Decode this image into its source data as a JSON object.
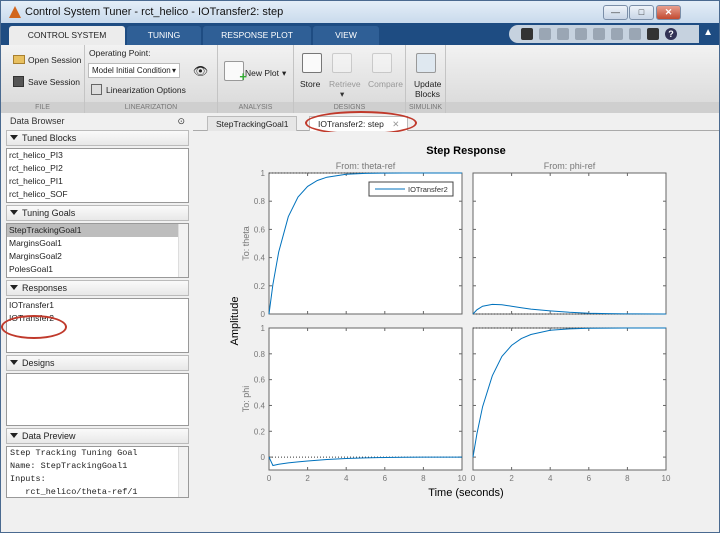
{
  "window": {
    "title": "Control System Tuner - rct_helico - IOTransfer2: step",
    "controls": [
      "minimize",
      "maximize",
      "close"
    ]
  },
  "ribbon_tabs": [
    {
      "label": "CONTROL SYSTEM",
      "active": true
    },
    {
      "label": "TUNING"
    },
    {
      "label": "RESPONSE PLOT"
    },
    {
      "label": "VIEW"
    }
  ],
  "quick_access": [
    "open-help-icon",
    "save-icon",
    "cut-icon",
    "copy-icon",
    "paste-icon",
    "undo-icon",
    "redo-icon",
    "layout-icon",
    "help-icon"
  ],
  "ribbon": {
    "file": {
      "label": "FILE",
      "open": "Open Session",
      "save": "Save Session"
    },
    "linearization": {
      "label": "LINEARIZATION",
      "op_label": "Operating Point:",
      "op_value": "Model Initial Condition",
      "options": "Linearization Options"
    },
    "analysis": {
      "label": "ANALYSIS",
      "new_plot": "New Plot"
    },
    "designs": {
      "label": "DESIGNS",
      "store": "Store",
      "retrieve": "Retrieve",
      "compare": "Compare"
    },
    "simulink": {
      "label": "SIMULINK",
      "update": "Update",
      "update2": "Blocks"
    }
  },
  "data_browser": {
    "title": "Data Browser",
    "tuned_blocks": {
      "label": "Tuned Blocks",
      "items": [
        "rct_helico_PI3",
        "rct_helico_PI2",
        "rct_helico_PI1",
        "rct_helico_SOF"
      ]
    },
    "tuning_goals": {
      "label": "Tuning Goals",
      "items": [
        "StepTrackingGoal1",
        "MarginsGoal1",
        "MarginsGoal2",
        "PolesGoal1"
      ],
      "selected": "StepTrackingGoal1"
    },
    "responses": {
      "label": "Responses",
      "items": [
        "IOTransfer1",
        "IOTransfer2"
      ]
    },
    "designs": {
      "label": "Designs",
      "items": []
    },
    "data_preview": {
      "label": "Data Preview",
      "lines": [
        "Step Tracking Tuning Goal",
        "Name: StepTrackingGoal1",
        "Inputs:",
        "   rct_helico/theta-ref/1"
      ]
    }
  },
  "doc_tabs": [
    {
      "label": "StepTrackingGoal1"
    },
    {
      "label": "IOTransfer2: step",
      "active": true,
      "close": "✕"
    }
  ],
  "colors": {
    "accent": "#1e4c82",
    "curve": "#0072bd",
    "highlight": "#c0392b"
  },
  "chart_data": {
    "type": "line",
    "title": "Step Response",
    "xlabel": "Time (seconds)",
    "ylabel": "Amplitude",
    "xlim": [
      0,
      10
    ],
    "xticks": [
      "0",
      "2",
      "4",
      "6",
      "8",
      "10"
    ],
    "legend": {
      "entry": "IOTransfer2",
      "placement": "top-right"
    },
    "columns": [
      "From: theta-ref",
      "From: phi-ref"
    ],
    "rows": [
      {
        "label": "To: theta",
        "ylim": [
          0,
          1
        ],
        "yticks": [
          "0",
          "0.2",
          "0.4",
          "0.6",
          "0.8",
          "1"
        ]
      },
      {
        "label": "To: phi",
        "ylim": [
          -0.1,
          1
        ],
        "yticks": [
          "0",
          "0.2",
          "0.4",
          "0.6",
          "0.8",
          "1"
        ]
      }
    ],
    "x": [
      0,
      0.2,
      0.5,
      1,
      1.5,
      2,
      2.5,
      3,
      4,
      5,
      6,
      7,
      8,
      10
    ],
    "series": [
      {
        "name": "IOTransfer2",
        "from": "theta-ref",
        "to": "theta",
        "values": [
          0,
          0.21,
          0.44,
          0.69,
          0.83,
          0.905,
          0.947,
          0.97,
          0.991,
          0.997,
          0.999,
          1,
          1,
          1
        ]
      },
      {
        "name": "IOTransfer2",
        "from": "phi-ref",
        "to": "theta",
        "values": [
          0,
          0.03,
          0.055,
          0.068,
          0.065,
          0.055,
          0.045,
          0.035,
          0.022,
          0.012,
          0.006,
          0.003,
          0.001,
          0
        ]
      },
      {
        "name": "IOTransfer2",
        "from": "theta-ref",
        "to": "phi",
        "values": [
          0,
          -0.065,
          -0.055,
          -0.045,
          -0.037,
          -0.03,
          -0.024,
          -0.019,
          -0.011,
          -0.006,
          -0.003,
          -0.001,
          0,
          0
        ]
      },
      {
        "name": "IOTransfer2",
        "from": "phi-ref",
        "to": "phi",
        "values": [
          0,
          0.18,
          0.39,
          0.63,
          0.78,
          0.865,
          0.918,
          0.95,
          0.982,
          0.993,
          0.998,
          0.999,
          1,
          1
        ]
      }
    ],
    "reference_lines": [
      1,
      0,
      0,
      1
    ]
  }
}
